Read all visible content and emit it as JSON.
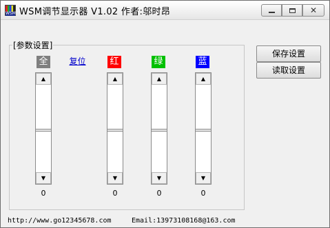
{
  "window": {
    "title": "WSM调节显示器  V1.02   作者:邬时昂",
    "icon_caption": "WSM",
    "controls": {
      "minimize": "minimize-icon",
      "maximize": "maximize-icon",
      "close": "✕"
    }
  },
  "group": {
    "label": "[参数设置]"
  },
  "channels": {
    "all": {
      "label": "全",
      "value": "0",
      "color": "#7f7f7f"
    },
    "red": {
      "label": "红",
      "value": "0",
      "color": "#ff0000"
    },
    "green": {
      "label": "绿",
      "value": "0",
      "color": "#00c000"
    },
    "blue": {
      "label": "蓝",
      "value": "0",
      "color": "#0000ff"
    }
  },
  "reset_label": "复位",
  "scroll_glyphs": {
    "up": "▲",
    "down": "▼"
  },
  "buttons": {
    "save": "保存设置",
    "load": "读取设置"
  },
  "footer": {
    "url": "http://www.go12345678.com",
    "email": "Email:13973108168@163.com"
  }
}
